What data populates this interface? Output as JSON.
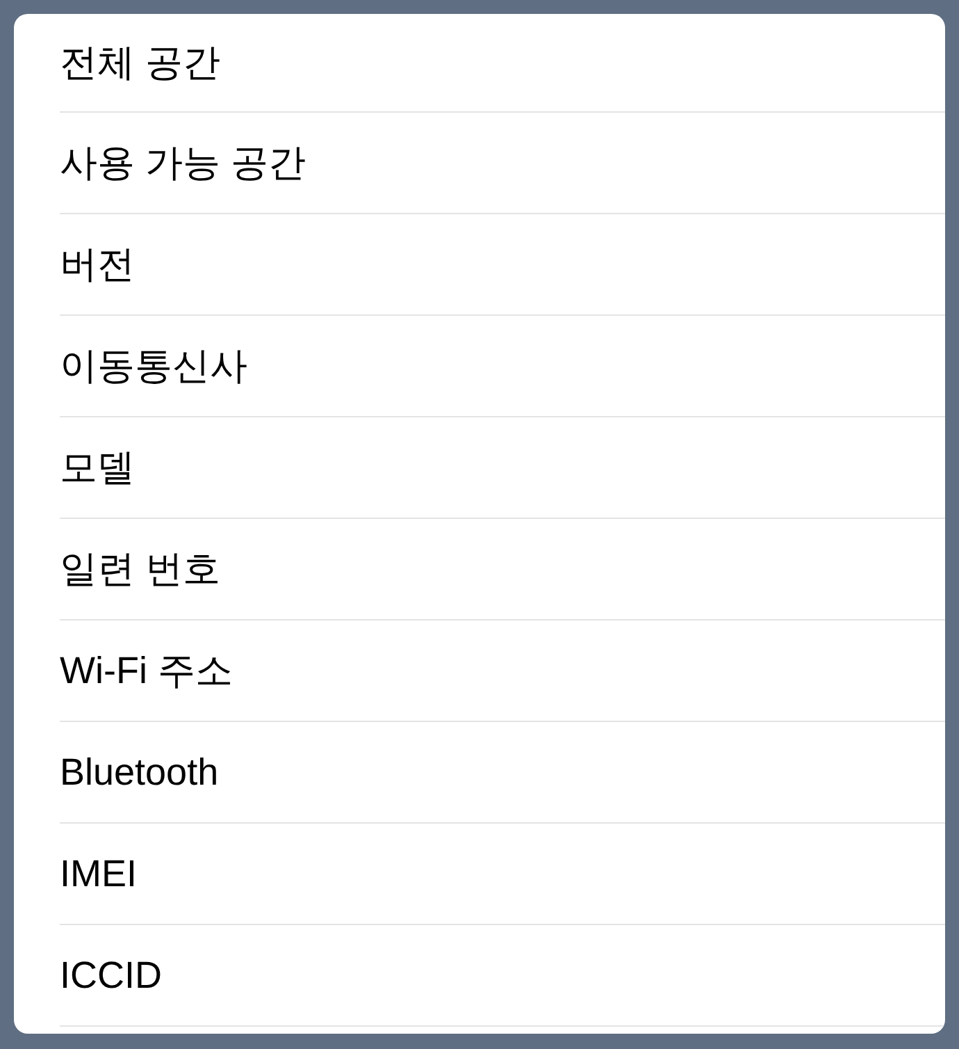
{
  "rows": [
    "전체 공간",
    "사용 가능 공간",
    "버전",
    "이동통신사",
    "모델",
    "일련 번호",
    "Wi-Fi 주소",
    "Bluetooth",
    "IMEI",
    "ICCID"
  ]
}
